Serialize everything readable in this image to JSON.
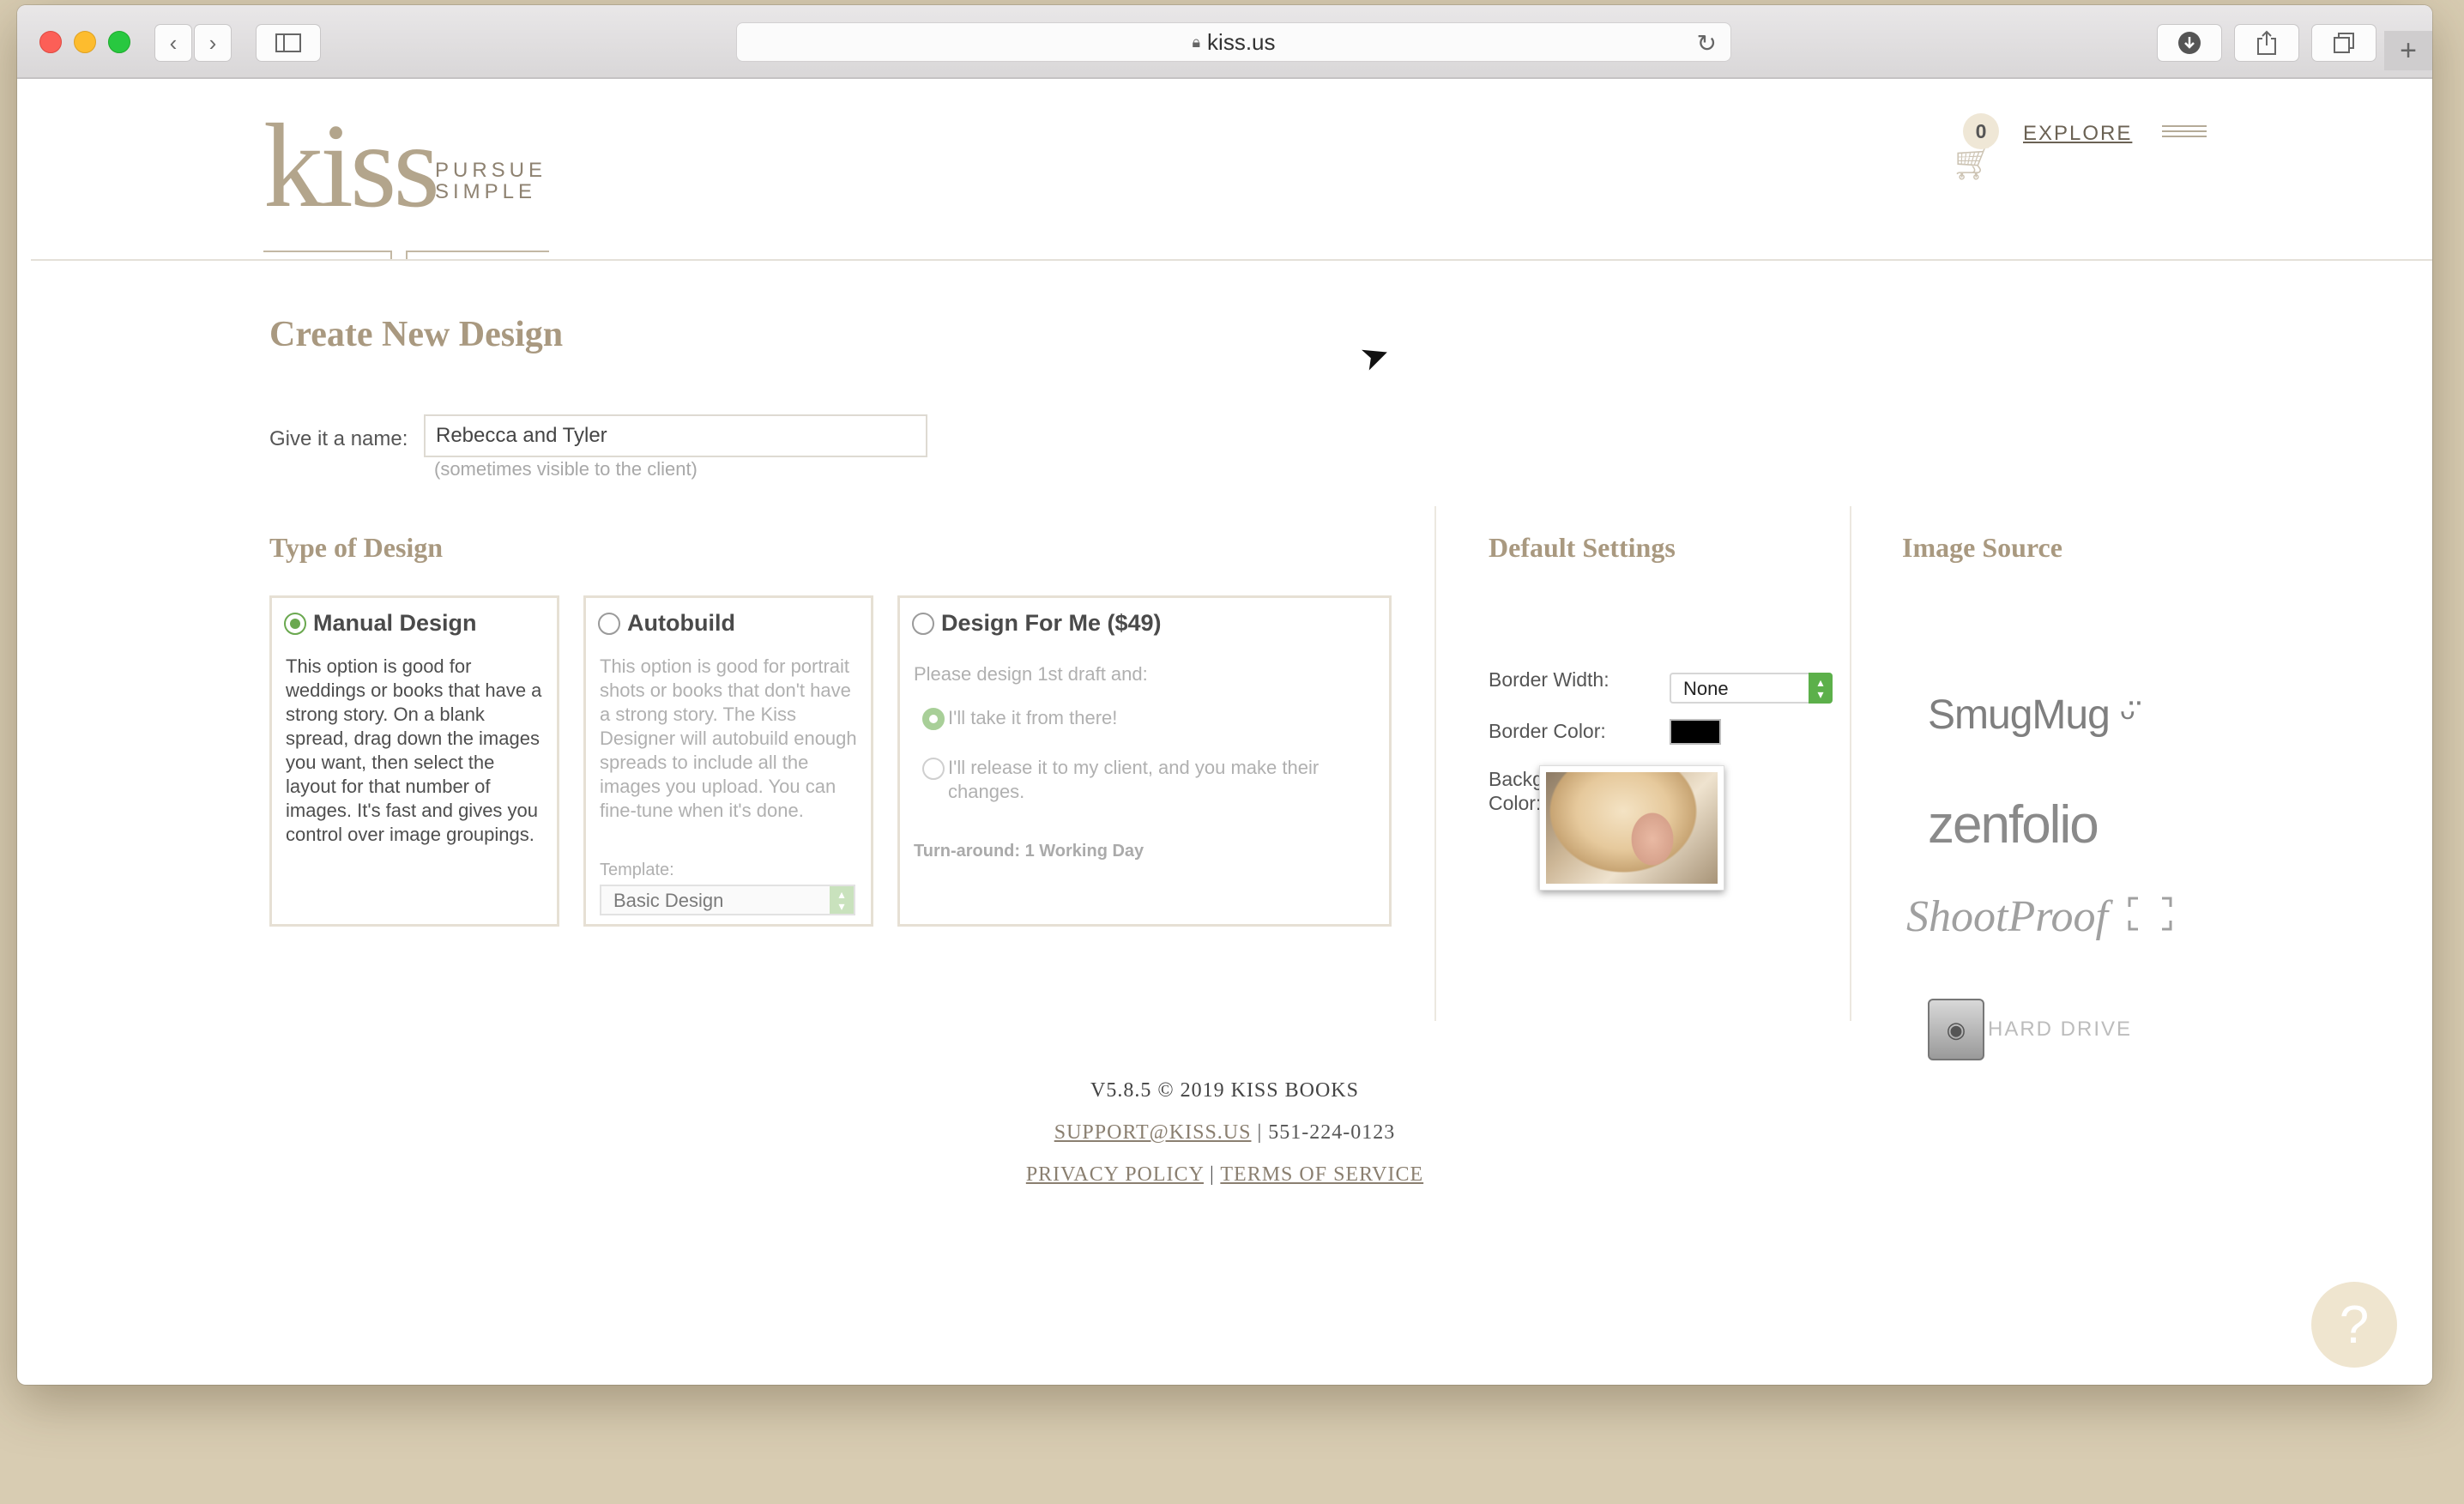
{
  "browser": {
    "url": "kiss.us",
    "icons": {
      "back": "chevron-left-icon",
      "forward": "chevron-right-icon",
      "sidebar": "sidebar-icon",
      "download": "download-icon",
      "share": "share-icon",
      "tabs": "tabs-icon",
      "new_tab": "plus-icon"
    }
  },
  "header": {
    "logo_main": "kiss",
    "logo_tag_1": "PURSUE",
    "logo_tag_2": "SIMPLE",
    "cart_count": "0",
    "explore_label": "EXPLORE"
  },
  "main": {
    "title": "Create New Design",
    "name_label": "Give it a name:",
    "name_value": "Rebecca and Tyler",
    "name_hint": "(sometimes visible to the client)",
    "type_section": {
      "title": "Type of Design",
      "manual": {
        "title": "Manual Design",
        "selected": true,
        "description": "This option is good for weddings or books that have a strong story. On a blank spread, drag down the images you want, then select the layout for that number of images. It's fast and gives you control over image groupings."
      },
      "autobuild": {
        "title": "Autobuild",
        "description": "This option is good for portrait shots or books that don't have a strong story. The Kiss Designer will autobuild enough spreads to include all the images you upload. You can fine-tune when it's done.",
        "template_label": "Template:",
        "template_value": "Basic Design"
      },
      "design_for_me": {
        "title": "Design For Me ($49)",
        "prompt": "Please design 1st draft and:",
        "option_1": "I'll take it from there!",
        "option_2": "I'll release it to my client, and you make their changes.",
        "turnaround": "Turn-around: 1 Working Day"
      }
    },
    "default_settings": {
      "title": "Default Settings",
      "border_width_label": "Border Width:",
      "border_width_value": "None",
      "border_color_label": "Border Color:",
      "border_color_value": "#000000",
      "background_color_label": "Background Color:",
      "background_color_value": "#ffffff"
    },
    "image_source": {
      "title": "Image Source",
      "smugmug": "SmugMug",
      "zenfolio": "zenfolio",
      "shootproof": "ShootProof",
      "hard_drive": "HARD DRIVE"
    }
  },
  "footer": {
    "version": "V5.8.5 © 2019 KISS BOOKS",
    "support_email": "SUPPORT@KISS.US",
    "separator": "|",
    "phone": "551-224-0123",
    "privacy": "PRIVACY POLICY",
    "terms": "TERMS OF SERVICE"
  },
  "help": {
    "label": "?"
  },
  "colors": {
    "accent": "#a99980",
    "selected_radio": "#6aa84f",
    "select_arrow": "#5cb04a"
  }
}
